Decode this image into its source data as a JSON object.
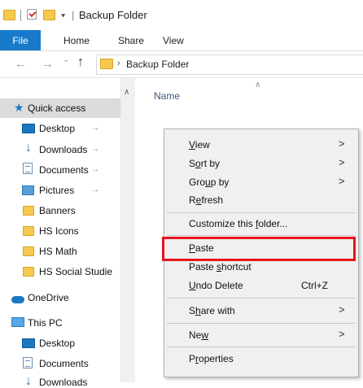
{
  "window": {
    "title": "Backup Folder",
    "qa_separator": "|",
    "qa_dropdown": "⯆"
  },
  "ribbon": {
    "tabs": [
      "File",
      "Home",
      "Share",
      "View"
    ]
  },
  "address": {
    "back": "←",
    "forward": "→",
    "recent": "⌄",
    "up": "↑",
    "chevron": "›",
    "path": "Backup Folder"
  },
  "navpane": {
    "scroll_up": "∧",
    "quick_access_label": "Quick access",
    "pin_glyph": "→",
    "quick_items": [
      {
        "label": "Desktop",
        "icon": "desktop-icon",
        "pinned": true
      },
      {
        "label": "Downloads",
        "icon": "downloads-icon",
        "pinned": true
      },
      {
        "label": "Documents",
        "icon": "documents-icon",
        "pinned": true
      },
      {
        "label": "Pictures",
        "icon": "pictures-icon",
        "pinned": true
      },
      {
        "label": "Banners",
        "icon": "folder-icon",
        "pinned": false
      },
      {
        "label": "HS Icons",
        "icon": "folder-icon",
        "pinned": false
      },
      {
        "label": "HS Math",
        "icon": "folder-icon",
        "pinned": false
      },
      {
        "label": "HS Social Studie",
        "icon": "folder-icon",
        "pinned": false
      }
    ],
    "onedrive_label": "OneDrive",
    "thispc_label": "This PC",
    "pc_items": [
      {
        "label": "Desktop",
        "icon": "desktop-icon"
      },
      {
        "label": "Documents",
        "icon": "documents-icon"
      },
      {
        "label": "Downloads",
        "icon": "downloads-icon"
      }
    ]
  },
  "content": {
    "column_name": "Name",
    "sort_caret": "∧"
  },
  "context_menu": {
    "submenu_arrow": ">",
    "view": {
      "pre": "",
      "key": "V",
      "post": "iew"
    },
    "sort_by": {
      "pre": "S",
      "key": "o",
      "post": "rt by"
    },
    "group_by": {
      "pre": "Gro",
      "key": "u",
      "post": "p by"
    },
    "refresh": {
      "pre": "R",
      "key": "e",
      "post": "fresh"
    },
    "customize": {
      "pre": "Customize this ",
      "key": "f",
      "post": "older..."
    },
    "paste": {
      "pre": "",
      "key": "P",
      "post": "aste"
    },
    "paste_shortcut": {
      "pre": "Paste ",
      "key": "s",
      "post": "hortcut"
    },
    "undo_delete": {
      "pre": "",
      "key": "U",
      "post": "ndo Delete"
    },
    "undo_shortcut": "Ctrl+Z",
    "share_with": {
      "pre": "S",
      "key": "h",
      "post": "are with"
    },
    "new": {
      "pre": "Ne",
      "key": "w",
      "post": ""
    },
    "properties": {
      "pre": "P",
      "key": "r",
      "post": "operties"
    }
  },
  "colors": {
    "file_tab": "#1979ca",
    "highlight_box": "#e8141c",
    "quick_access_selected": "#dcdcdc"
  }
}
